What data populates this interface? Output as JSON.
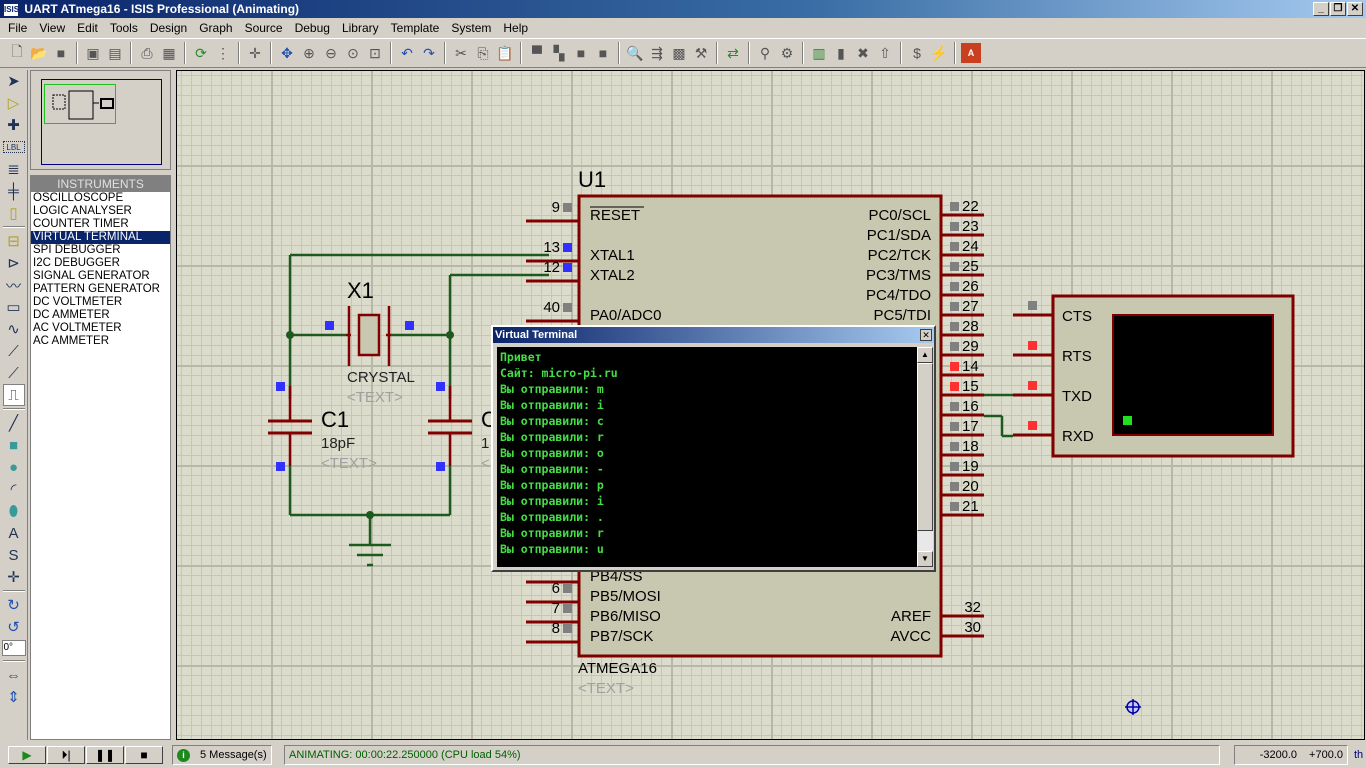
{
  "window": {
    "title": "UART ATmega16 - ISIS Professional (Animating)",
    "app_icon": "ISIS",
    "minimize": "_",
    "restore": "❐",
    "close": "✕"
  },
  "menu": [
    "File",
    "View",
    "Edit",
    "Tools",
    "Design",
    "Graph",
    "Source",
    "Debug",
    "Library",
    "Template",
    "System",
    "Help"
  ],
  "toolbar": {
    "groups": [
      [
        "new-file-icon",
        "open-folder-icon",
        "save-icon"
      ],
      [
        "import-icon",
        "export-icon"
      ],
      [
        "print-icon",
        "print-area-icon"
      ],
      [
        "refresh-icon",
        "grid-toggle-icon"
      ],
      [
        "origin-icon"
      ],
      [
        "pan-icon",
        "zoom-in-icon",
        "zoom-out-icon",
        "zoom-all-icon",
        "zoom-area-icon"
      ],
      [
        "undo-icon",
        "redo-icon"
      ],
      [
        "cut-icon",
        "copy-icon",
        "paste-icon"
      ],
      [
        "block-copy-icon",
        "block-move-icon",
        "block-rotate-icon",
        "block-delete-icon"
      ],
      [
        "pick-device-icon",
        "make-device-icon",
        "packaging-icon",
        "decompose-icon"
      ],
      [
        "wire-autorouter-icon"
      ],
      [
        "search-tag-icon",
        "property-tool-icon"
      ],
      [
        "new-sheet-icon",
        "remove-sheet-icon",
        "exit-to-parent-icon",
        "goto-sheet-icon"
      ],
      [
        "bill-of-materials-icon",
        "electrical-rules-icon"
      ],
      [
        "ares-netlist-icon"
      ]
    ],
    "glyphs": {
      "new-file-icon": "🗋",
      "open-folder-icon": "📂",
      "save-icon": "■",
      "import-icon": "▣",
      "export-icon": "▤",
      "print-icon": "⎙",
      "print-area-icon": "▦",
      "refresh-icon": "⟳",
      "grid-toggle-icon": "⋮",
      "origin-icon": "✛",
      "pan-icon": "✥",
      "zoom-in-icon": "⊕",
      "zoom-out-icon": "⊖",
      "zoom-all-icon": "⊙",
      "zoom-area-icon": "⊡",
      "undo-icon": "↶",
      "redo-icon": "↷",
      "cut-icon": "✂",
      "copy-icon": "⎘",
      "paste-icon": "📋",
      "block-copy-icon": "▀",
      "block-move-icon": "▚",
      "block-rotate-icon": "■",
      "block-delete-icon": "■",
      "pick-device-icon": "🔍",
      "make-device-icon": "⇶",
      "packaging-icon": "▩",
      "decompose-icon": "⚒",
      "wire-autorouter-icon": "⇄",
      "search-tag-icon": "⚲",
      "property-tool-icon": "⚙",
      "new-sheet-icon": "▥",
      "remove-sheet-icon": "▮",
      "exit-to-parent-icon": "✖",
      "goto-sheet-icon": "⇧",
      "bill-of-materials-icon": "$",
      "electrical-rules-icon": "⚡",
      "ares-netlist-icon": "A"
    }
  },
  "left_tools": [
    {
      "name": "selection-mode-icon",
      "glyph": "➤"
    },
    {
      "name": "component-mode-icon",
      "glyph": "▷"
    },
    {
      "name": "junction-dot-icon",
      "glyph": "✚"
    },
    {
      "name": "wire-label-icon",
      "glyph": "LBL"
    },
    {
      "name": "text-script-icon",
      "glyph": "≣"
    },
    {
      "name": "buses-icon",
      "glyph": "╪"
    },
    {
      "name": "subcircuit-icon",
      "glyph": "▯"
    },
    {
      "sep": true
    },
    {
      "name": "terminals-icon",
      "glyph": "⊟"
    },
    {
      "name": "device-pins-icon",
      "glyph": "⊳"
    },
    {
      "name": "graph-mode-icon",
      "glyph": "〰"
    },
    {
      "name": "tape-recorder-icon",
      "glyph": "▭"
    },
    {
      "name": "generator-icon",
      "glyph": "∿"
    },
    {
      "name": "voltage-probe-icon",
      "glyph": "⟋"
    },
    {
      "name": "current-probe-icon",
      "glyph": "⟋"
    },
    {
      "name": "virtual-instruments-icon",
      "glyph": "⎍"
    },
    {
      "sep": true
    },
    {
      "name": "line-tool-icon",
      "glyph": "╱"
    },
    {
      "name": "box-tool-icon",
      "glyph": "■"
    },
    {
      "name": "circle-tool-icon",
      "glyph": "●"
    },
    {
      "name": "arc-tool-icon",
      "glyph": "◜"
    },
    {
      "name": "path-tool-icon",
      "glyph": "⬮"
    },
    {
      "name": "text-tool-icon",
      "glyph": "A"
    },
    {
      "name": "symbol-tool-icon",
      "glyph": "S"
    },
    {
      "name": "marker-tool-icon",
      "glyph": "✛"
    },
    {
      "sep": true
    },
    {
      "name": "rotate-clockwise-icon",
      "glyph": "↻"
    },
    {
      "name": "rotate-anticlockwise-icon",
      "glyph": "↺"
    },
    {
      "angle": "0°"
    },
    {
      "sep": true
    },
    {
      "name": "mirror-x-icon",
      "glyph": "⇔"
    },
    {
      "name": "mirror-y-icon",
      "glyph": "⇕"
    }
  ],
  "instruments": {
    "header": "INSTRUMENTS",
    "selected": "VIRTUAL TERMINAL",
    "items": [
      "OSCILLOSCOPE",
      "LOGIC ANALYSER",
      "COUNTER TIMER",
      "VIRTUAL TERMINAL",
      "SPI DEBUGGER",
      "I2C DEBUGGER",
      "SIGNAL GENERATOR",
      "PATTERN GENERATOR",
      "DC VOLTMETER",
      "DC AMMETER",
      "AC VOLTMETER",
      "AC AMMETER"
    ]
  },
  "schematic": {
    "u1": {
      "ref": "U1",
      "part": "ATMEGA16",
      "text": "<TEXT>",
      "left_pins": [
        {
          "num": "9",
          "name": "RESET",
          "overline": true,
          "state": "gray"
        },
        {
          "num": "13",
          "name": "XTAL1",
          "state": "blue"
        },
        {
          "num": "12",
          "name": "XTAL2",
          "state": "blue"
        },
        {
          "num": "40",
          "name": "PA0/ADC0",
          "state": "gray"
        },
        {
          "num": "6",
          "name": "PB5/MOSI",
          "state": "gray"
        },
        {
          "num": "7",
          "name": "PB6/MISO",
          "state": "gray"
        },
        {
          "num": "8",
          "name": "PB7/SCK",
          "state": "gray"
        }
      ],
      "partial_pin_label": "PB4/SS",
      "right_pins": [
        {
          "num": "22",
          "name": "PC0/SCL",
          "state": "gray"
        },
        {
          "num": "23",
          "name": "PC1/SDA",
          "state": "gray"
        },
        {
          "num": "24",
          "name": "PC2/TCK",
          "state": "gray"
        },
        {
          "num": "25",
          "name": "PC3/TMS",
          "state": "gray"
        },
        {
          "num": "26",
          "name": "PC4/TDO",
          "state": "gray"
        },
        {
          "num": "27",
          "name": "PC5/TDI",
          "state": "gray"
        },
        {
          "num": "28",
          "name": "",
          "state": "gray"
        },
        {
          "num": "29",
          "name": "",
          "state": "gray"
        },
        {
          "num": "14",
          "name": "",
          "state": "red"
        },
        {
          "num": "15",
          "name": "",
          "state": "red"
        },
        {
          "num": "16",
          "name": "",
          "state": "gray"
        },
        {
          "num": "17",
          "name": "",
          "state": "gray"
        },
        {
          "num": "18",
          "name": "",
          "state": "gray"
        },
        {
          "num": "19",
          "name": "",
          "state": "gray"
        },
        {
          "num": "20",
          "name": "",
          "state": "gray"
        },
        {
          "num": "21",
          "name": "",
          "state": "gray"
        }
      ],
      "power_pins": [
        {
          "num": "32",
          "name": "AREF"
        },
        {
          "num": "30",
          "name": "AVCC"
        }
      ]
    },
    "x1": {
      "ref": "X1",
      "part": "CRYSTAL",
      "text": "<TEXT>"
    },
    "c1": {
      "ref": "C1",
      "value": "18pF",
      "text": "<TEXT>"
    },
    "c2": {
      "ref": "C",
      "value": "1",
      "text": "<"
    },
    "vt": {
      "pins": [
        "CTS",
        "RTS",
        "TXD",
        "RXD"
      ],
      "pin_states": [
        "gray",
        "red",
        "red",
        "red"
      ]
    }
  },
  "virtual_terminal": {
    "title": "Virtual Terminal",
    "close": "✕",
    "lines": [
      "Привет",
      "Сайт: micro-pi.ru",
      "Вы отправили: m",
      "Вы отправили: i",
      "Вы отправили: c",
      "Вы отправили: r",
      "Вы отправили: o",
      "Вы отправили: -",
      "Вы отправили: p",
      "Вы отправили: i",
      "Вы отправили: .",
      "Вы отправили: r",
      "Вы отправили: u"
    ],
    "scroll_up": "▲",
    "scroll_down": "▼"
  },
  "status": {
    "play": "▶",
    "step": "⏵|",
    "pause": "❚❚",
    "stop": "■",
    "messages": "5 Message(s)",
    "animating": "ANIMATING: 00:00:22.250000 (CPU load 54%)",
    "coord_x": "-3200.0",
    "coord_y": "+700.0",
    "units": "th"
  },
  "colors": {
    "wire": "#1e5a1e",
    "body_border": "#800000",
    "body_fill": "#c8c8b0",
    "pin_blue": "#3030ff",
    "pin_red": "#ff3030",
    "pin_gray": "#808080",
    "term_text": "#44dd44"
  }
}
